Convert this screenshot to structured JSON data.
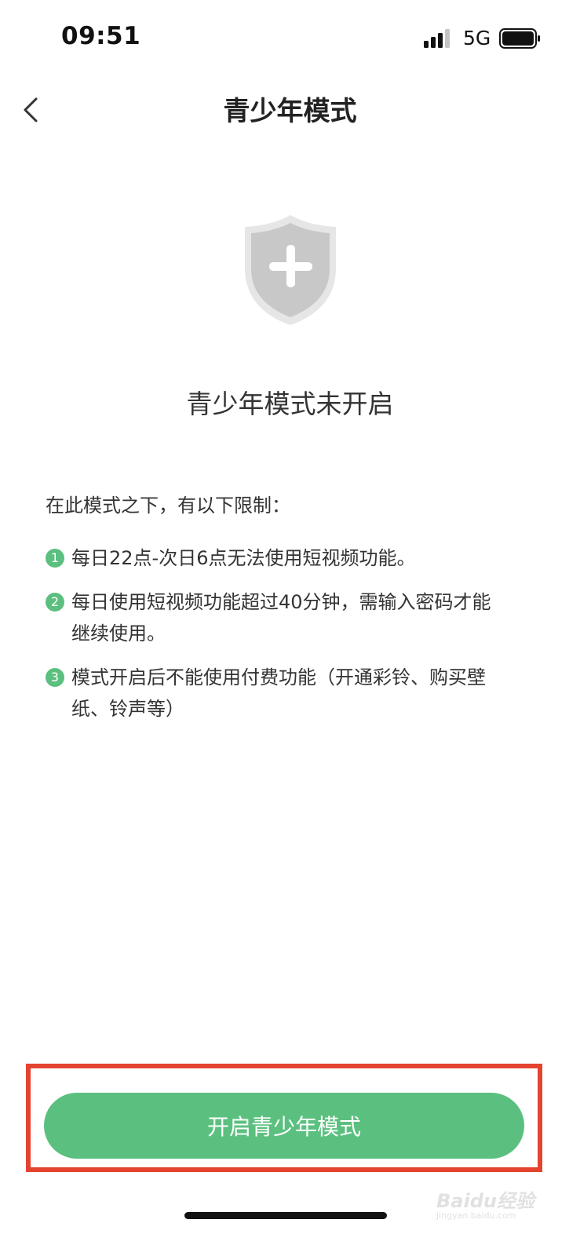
{
  "status_bar": {
    "time": "09:51",
    "network": "5G",
    "icons": [
      "signal-icon",
      "battery-icon"
    ]
  },
  "nav": {
    "title": "青少年模式",
    "back_icon": "chevron-left-icon"
  },
  "shield_icon": "shield-plus-icon",
  "status_title": "青少年模式未开启",
  "limits": {
    "intro": "在此模式之下，有以下限制：",
    "items": [
      {
        "num": "1",
        "text": "每日22点-次日6点无法使用短视频功能。"
      },
      {
        "num": "2",
        "text": "每日使用短视频功能超过40分钟，需输入密码才能继续使用。"
      },
      {
        "num": "3",
        "text": "模式开启后不能使用付费功能（开通彩铃、购买壁纸、铃声等）"
      }
    ]
  },
  "button": {
    "label": "开启青少年模式"
  },
  "watermark": {
    "text": "Baidu经验",
    "sub": "jingyan.baidu.com"
  },
  "colors": {
    "accent": "#5bc07f",
    "highlight": "#e4432f",
    "shield": "#c8c8c8"
  }
}
